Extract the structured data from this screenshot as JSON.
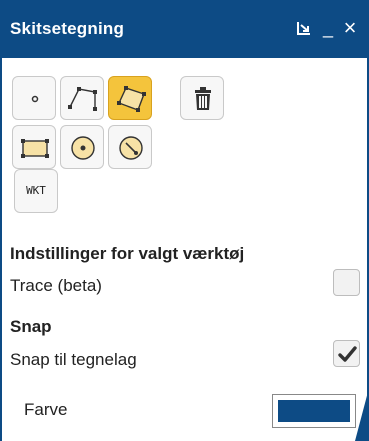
{
  "window": {
    "title": "Skitsetegning",
    "buttons": {
      "dock_glyph": "⤓",
      "minimize_glyph": "_",
      "close_glyph": "×"
    }
  },
  "tools": {
    "row1": [
      "point-tool",
      "line-tool",
      "polygon-tool",
      "delete-tool"
    ],
    "row2": [
      "rectangle-tool",
      "circle-tool",
      "radius-circle-tool"
    ],
    "active": "polygon-tool",
    "wkt_label": "WKT"
  },
  "settings": {
    "heading": "Indstillinger for valgt værktøj",
    "trace_label": "Trace (beta)",
    "trace_checked": false,
    "snap_heading": "Snap",
    "snap_label": "Snap til tegnelag",
    "snap_checked": true,
    "color_label": "Farve",
    "color_value": "#0d4b85"
  },
  "colors": {
    "titlebar": "#0d4b85",
    "active_tool": "#f4c43c",
    "shape_fill": "#f7e2a6"
  }
}
